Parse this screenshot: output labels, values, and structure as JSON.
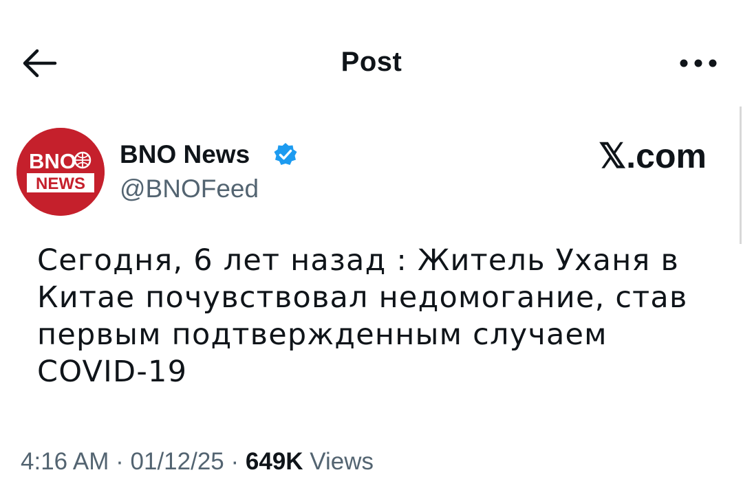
{
  "header": {
    "title": "Post",
    "back_icon": "arrow-left-icon",
    "more_icon": "more-dots-icon"
  },
  "author": {
    "avatar_text_top": "BNO",
    "avatar_text_bottom": "NEWS",
    "display_name": "BNO News",
    "handle": "@BNOFeed",
    "verified_badge": "verified-badge-icon"
  },
  "watermark": "𝕏.com",
  "tweet": {
    "lines": [
      "Сегодня, 6 лет назад : Житель Уханя в",
      "Китае почувствовал недомогание, став",
      "первым подтвержденным случаем",
      "COVID-19"
    ]
  },
  "meta": {
    "time": "4:16 AM",
    "sep1": " · ",
    "date": "01/12/25",
    "sep2": " · ",
    "views_count": "649K",
    "views_label": " Views"
  },
  "colors": {
    "brand_red": "#c5202c",
    "verified_blue": "#1d9bf0",
    "muted_text": "#536471"
  }
}
